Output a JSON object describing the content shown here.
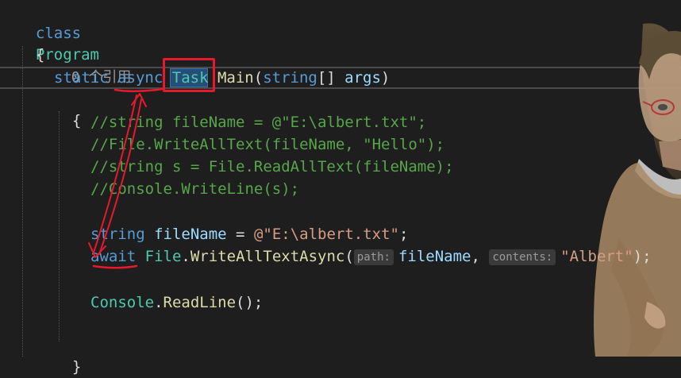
{
  "code": {
    "line1": {
      "kw": "class",
      "name": "Program"
    },
    "line2": {
      "brace": "{"
    },
    "line3": {
      "refs": "0 个引用"
    },
    "line4": {
      "static": "static",
      "async": "async",
      "task": "Task",
      "main": "Main",
      "lparen": "(",
      "string": "string",
      "brackets": "[] ",
      "args": "args",
      "rparen": ")"
    },
    "line5": {
      "brace": "{"
    },
    "comments": [
      "//string fileName = @\"E:\\albert.txt\";",
      "//File.WriteAllText(fileName, \"Hello\");",
      "//string s = File.ReadAllText(fileName);",
      "//Console.WriteLine(s);"
    ],
    "line10": {
      "string": "string",
      "var": "fileName",
      "eq": " = ",
      "value": "@\"E:\\albert.txt\"",
      "semi": ";"
    },
    "line11": {
      "await": "await",
      "file": "File",
      "dot": ".",
      "method": "WriteAllTextAsync",
      "lparen": "(",
      "hint1": "path:",
      "arg1": "fileName",
      "comma": ", ",
      "hint2": "contents:",
      "arg2": "\"Albert\"",
      "end": ");"
    },
    "line13": {
      "console": "Console",
      "dot": ".",
      "method": "ReadLine",
      "end": "();"
    },
    "line15": {
      "brace": "}"
    }
  },
  "colors": {
    "background": "#1e1e1e",
    "keyword": "#569cd6",
    "type": "#4ec9b0",
    "method": "#dcdcaa",
    "identifier": "#9cdcfe",
    "comment": "#57a64a",
    "string": "#d69d85",
    "annotation": "#e8192c"
  }
}
